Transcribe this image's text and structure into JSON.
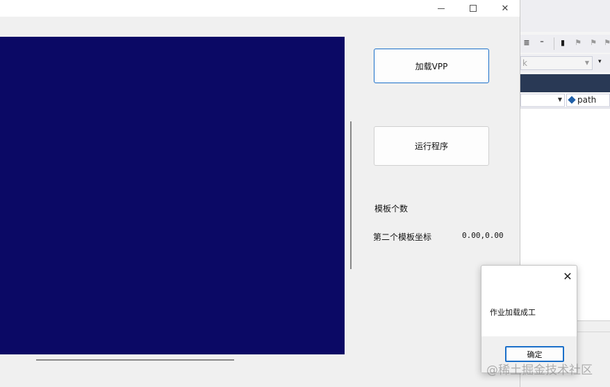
{
  "background_ide": {
    "nav_combo_value": "path",
    "toolbar_combo_value": "k",
    "colors": {
      "blue_bar": "#293955"
    }
  },
  "app": {
    "buttons": {
      "load_vpp": "加载VPP",
      "run_program": "运行程序"
    },
    "labels": {
      "template_count": "模板个数",
      "second_template_coord": "第二个模板坐标",
      "second_template_coord_value": "0.00,0.00"
    },
    "canvas_color": "#0b0965"
  },
  "message_box": {
    "text": "作业加载成工",
    "ok_label": "确定",
    "close_icon": "close-icon"
  },
  "watermark": "@稀土掘金技术社区"
}
